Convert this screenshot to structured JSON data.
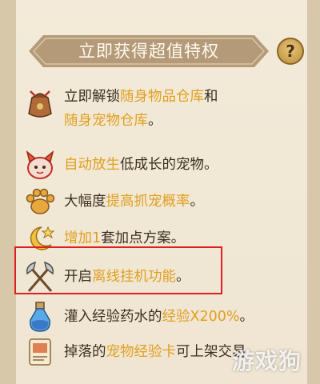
{
  "header": {
    "title": "立即获得超值特权",
    "help_label": "?"
  },
  "rows": [
    {
      "icon": "sack-icon",
      "parts": [
        "立即解锁",
        "随身物品仓库",
        "和"
      ],
      "parts2": [
        "随身宠物仓库",
        "。"
      ]
    },
    {
      "icon": "pet-release-icon",
      "parts": [
        "自动放生",
        "低成长的宠物。"
      ]
    },
    {
      "icon": "paw-icon",
      "parts": [
        "大幅度",
        "提高抓宠概率",
        "。"
      ]
    },
    {
      "icon": "moon-star-icon",
      "parts": [
        "增加",
        "1",
        "套加点方案。"
      ]
    },
    {
      "icon": "crossed-axes-icon",
      "parts": [
        "开启",
        "离线挂机功能",
        "。"
      ]
    },
    {
      "icon": "potion-icon",
      "parts": [
        "灌入经验药水的",
        "经验X200%",
        "。"
      ]
    },
    {
      "icon": "card-scroll-icon",
      "parts": [
        "掉落的",
        "宠物经验卡",
        "可上架交易"
      ]
    }
  ],
  "watermark": "游戏狗",
  "colors": {
    "highlight": "#e0a020",
    "banner": "#b49a78",
    "text": "#3d2f20",
    "box": "#e02020"
  }
}
